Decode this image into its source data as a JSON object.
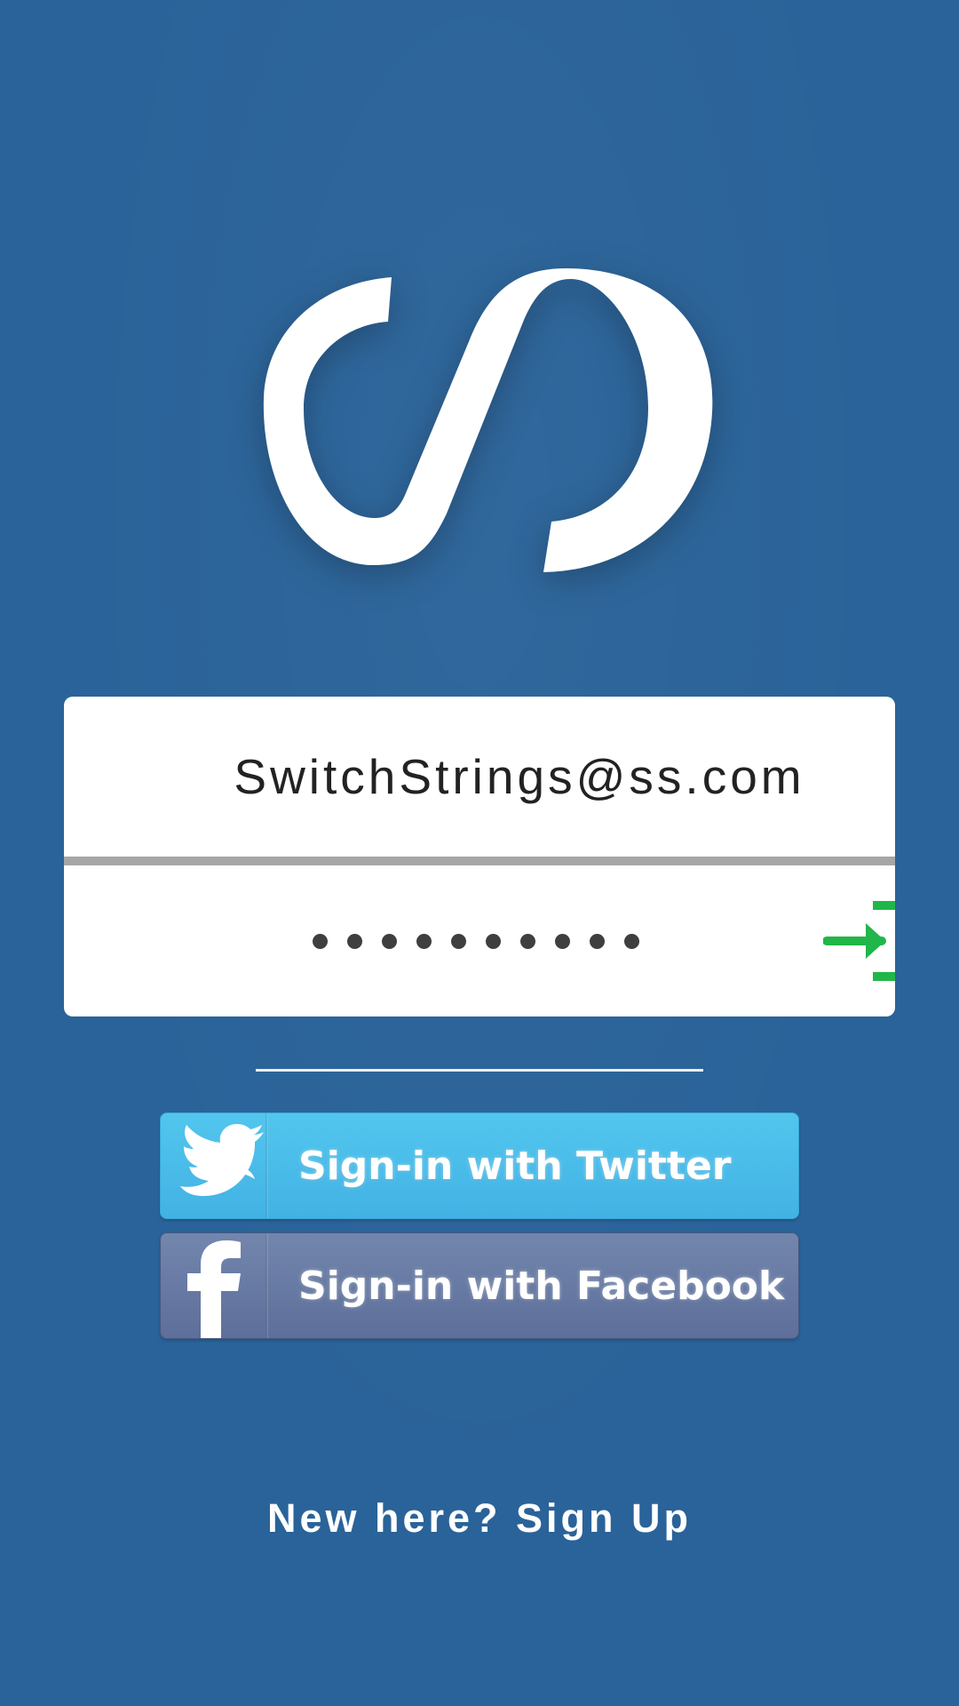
{
  "colors": {
    "background": "#2a6399",
    "card": "#ffffff",
    "divider": "#a6a6a6",
    "password_dot": "#3f3f3f",
    "signin_icon": "#20b64a",
    "twitter": "#47b8e8",
    "facebook": "#667aa4",
    "text_light": "#ffffff"
  },
  "logo": {
    "icon": "switchstrings-logo-icon"
  },
  "login_form": {
    "email": {
      "value": "SwitchStrings@ss.com",
      "placeholder": ""
    },
    "password": {
      "masked_length": 10
    },
    "submit": {
      "icon": "sign-in-arrow-icon"
    }
  },
  "social": {
    "twitter": {
      "label": "Sign-in with Twitter",
      "icon": "twitter-bird-icon"
    },
    "facebook": {
      "label": "Sign-in with Facebook",
      "icon": "facebook-f-icon"
    }
  },
  "footer": {
    "signup_text": "New here? Sign Up"
  }
}
